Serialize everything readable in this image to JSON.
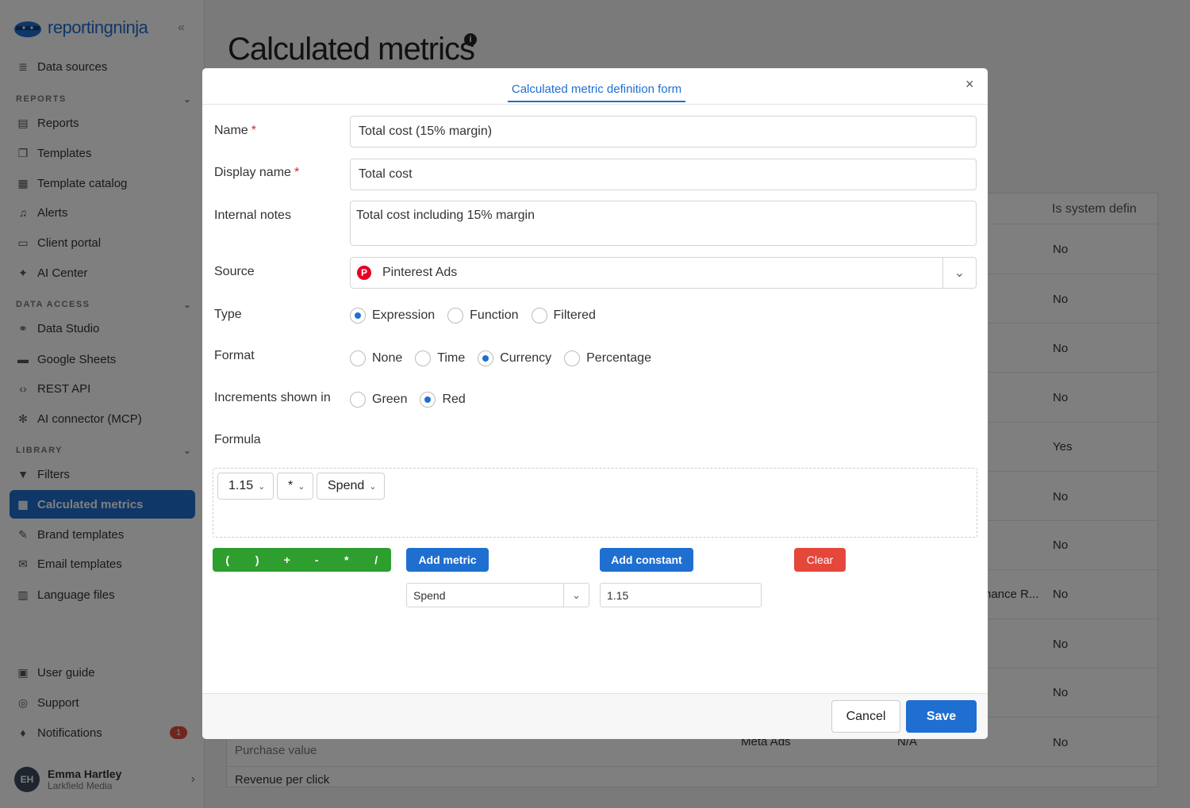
{
  "app": {
    "logo_text": "reportingninja"
  },
  "sidebar": {
    "items_top": [
      {
        "label": "Data sources",
        "icon": "database-icon"
      }
    ],
    "sections": [
      {
        "title": "REPORTS",
        "items": [
          {
            "label": "Reports",
            "icon": "reports-icon"
          },
          {
            "label": "Templates",
            "icon": "templates-icon"
          },
          {
            "label": "Template catalog",
            "icon": "grid-icon"
          },
          {
            "label": "Alerts",
            "icon": "bell-icon"
          },
          {
            "label": "Client portal",
            "icon": "monitor-icon"
          },
          {
            "label": "AI Center",
            "icon": "sparkle-icon"
          }
        ]
      },
      {
        "title": "DATA ACCESS",
        "items": [
          {
            "label": "Data Studio",
            "icon": "link-icon"
          },
          {
            "label": "Google Sheets",
            "icon": "sheet-icon"
          },
          {
            "label": "REST API",
            "icon": "code-icon"
          },
          {
            "label": "AI connector (MCP)",
            "icon": "connector-icon"
          }
        ]
      },
      {
        "title": "LIBRARY",
        "items": [
          {
            "label": "Filters",
            "icon": "filter-icon"
          },
          {
            "label": "Calculated metrics",
            "icon": "calculator-icon"
          },
          {
            "label": "Brand templates",
            "icon": "brush-icon"
          },
          {
            "label": "Email templates",
            "icon": "mail-icon"
          },
          {
            "label": "Language files",
            "icon": "language-icon"
          }
        ]
      }
    ],
    "bottom": [
      {
        "label": "User guide",
        "icon": "book-icon"
      },
      {
        "label": "Support",
        "icon": "support-icon"
      },
      {
        "label": "Notifications",
        "icon": "bell-icon",
        "badge": "1"
      }
    ],
    "user": {
      "initials": "EH",
      "name": "Emma Hartley",
      "org": "Larkfield Media"
    }
  },
  "page": {
    "title": "Calculated metrics",
    "table": {
      "col_header": "Is system defin",
      "system_values": [
        "No",
        "No",
        "No",
        "No",
        "Yes",
        "No",
        "No",
        "No",
        "No",
        "No",
        "No"
      ],
      "partial_text": "nance R...",
      "rows_bottom": [
        "Purchase value",
        "Revenue per click"
      ],
      "source_bottom": "Meta Ads",
      "na": "N/A"
    }
  },
  "modal": {
    "tab": "Calculated metric definition form",
    "close": "×",
    "fields": {
      "name": {
        "label": "Name",
        "value": "Total cost (15% margin)"
      },
      "display_name": {
        "label": "Display name",
        "value": "Total cost"
      },
      "notes": {
        "label": "Internal notes",
        "value": "Total cost including 15% margin"
      },
      "source": {
        "label": "Source",
        "value": "Pinterest Ads"
      },
      "type": {
        "label": "Type",
        "options": [
          "Expression",
          "Function",
          "Filtered"
        ],
        "selected": "Expression"
      },
      "format": {
        "label": "Format",
        "options": [
          "None",
          "Time",
          "Currency",
          "Percentage"
        ],
        "selected": "Currency"
      },
      "increments": {
        "label": "Increments shown in",
        "options": [
          "Green",
          "Red"
        ],
        "selected": "Red"
      },
      "formula": {
        "label": "Formula",
        "tokens": [
          "1.15",
          "*",
          "Spend"
        ]
      }
    },
    "operators": [
      "(",
      ")",
      "+",
      "-",
      "*",
      "/"
    ],
    "add_metric": "Add metric",
    "add_constant": "Add constant",
    "clear": "Clear",
    "metric_select": "Spend",
    "constant_value": "1.15",
    "cancel": "Cancel",
    "save": "Save",
    "colors": {
      "accent": "#1f6fd1",
      "operators": "#2e9f2e",
      "danger": "#e5473b"
    }
  }
}
